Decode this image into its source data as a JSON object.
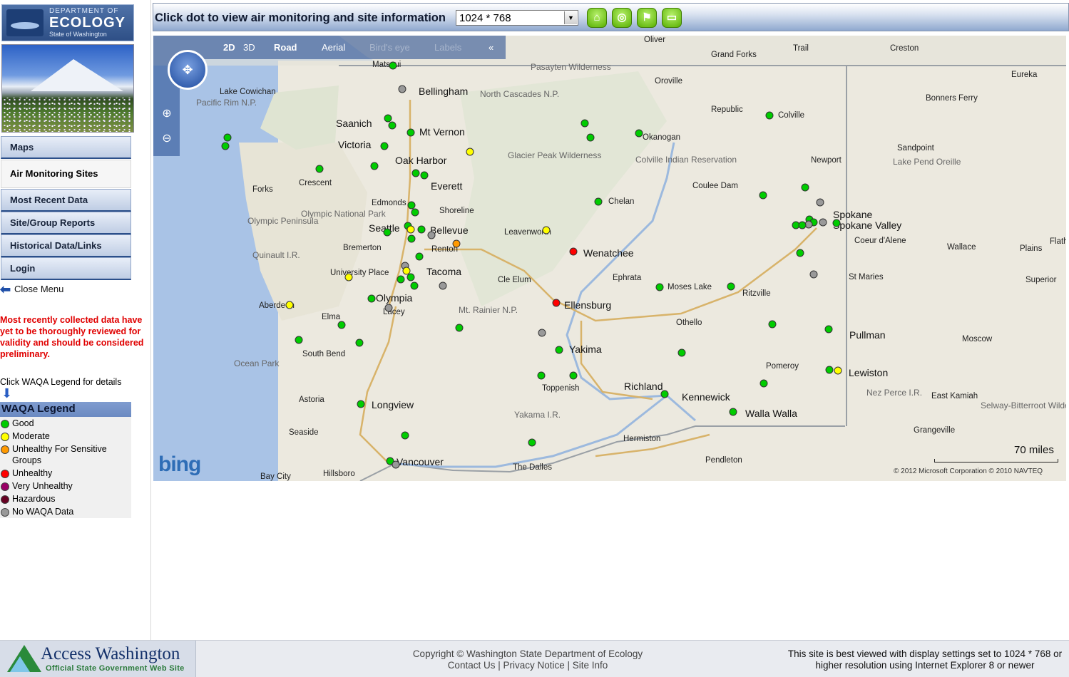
{
  "agency": {
    "line1": "DEPARTMENT OF",
    "line2": "ECOLOGY",
    "line3": "State of Washington"
  },
  "menu": {
    "items": [
      "Maps",
      "Air Monitoring Sites",
      "Most Recent Data",
      "Site/Group Reports",
      "Historical Data/Links",
      "Login"
    ],
    "active": "Air Monitoring Sites",
    "close_label": "Close Menu"
  },
  "notice": {
    "disclaimer": "Most recently collected data have yet to be thoroughly reviewed for validity and should be considered preliminary.",
    "legend_hint": "Click WAQA Legend for details"
  },
  "legend": {
    "title": "WAQA Legend",
    "entries": [
      {
        "label": "Good",
        "color": "#00cc00"
      },
      {
        "label": "Moderate",
        "color": "#ffff00"
      },
      {
        "label": "Unhealthy For Sensitive Groups",
        "color": "#ff9900"
      },
      {
        "label": "Unhealthy",
        "color": "#ff0000"
      },
      {
        "label": "Very Unhealthy",
        "color": "#990066"
      },
      {
        "label": "Hazardous",
        "color": "#660022"
      },
      {
        "label": "No WAQA Data",
        "color": "#999999"
      }
    ]
  },
  "toolbar": {
    "title": "Click dot to view air monitoring and site information",
    "resolution": "1024 * 768",
    "buttons": [
      {
        "icon": "home-icon",
        "glyph": "⌂"
      },
      {
        "icon": "globe-icon",
        "glyph": "◎"
      },
      {
        "icon": "flag-icon",
        "glyph": "⚑"
      },
      {
        "icon": "comment-icon",
        "glyph": "▭"
      }
    ]
  },
  "map_nav": {
    "options": [
      "2D",
      "3D",
      "Road",
      "Aerial",
      "Bird's eye",
      "Labels"
    ],
    "collapse": "«",
    "scale": "70 miles",
    "copyright": "© 2012 Microsoft Corporation   © 2010 NAVTEQ",
    "logo": "bing"
  },
  "map_labels": {
    "cities": [
      "Bellingham",
      "Mt Vernon",
      "Saanich",
      "Victoria",
      "Oak Harbor",
      "Everett",
      "Edmonds",
      "Shoreline",
      "Seattle",
      "Bellevue",
      "Bremerton",
      "Renton",
      "University Place",
      "Tacoma",
      "Olympia",
      "Lacey",
      "Aberdeen",
      "Wenatchee",
      "Ellensburg",
      "Yakima",
      "Richland",
      "Kennewick",
      "Walla Walla",
      "Spokane",
      "Spokane Valley",
      "Pullman",
      "Lewiston",
      "Longview",
      "Vancouver",
      "Colville",
      "Okanogan",
      "Chelan",
      "Leavenworth",
      "Moses Lake",
      "Toppenish",
      "Moscow",
      "Coeur d'Alene"
    ],
    "small": [
      "Matsqui",
      "Lake Cowichan",
      "Pacific Rim N.P.",
      "Forks",
      "Crescent",
      "Olympic Peninsula",
      "Olympic National Park",
      "Quinault I.R.",
      "Elma",
      "South Bend",
      "Ocean Park",
      "Astoria",
      "Seaside",
      "Bay City",
      "Hillsboro",
      "The Dalles",
      "Hermiston",
      "Pendleton",
      "Mt. Rainier N.P.",
      "Cle Elum",
      "Ephrata",
      "Othello",
      "Ritzville",
      "Pomeroy",
      "Nez Perce I.R.",
      "East Kamiah",
      "Grangeville",
      "Colville Indian Reservation",
      "Coulee Dam",
      "Republic",
      "Oroville",
      "Grand Forks",
      "Trail",
      "Creston",
      "Eureka",
      "Bonners Ferry",
      "Sandpoint",
      "Newport",
      "Wallace",
      "Plains",
      "Superior",
      "St Maries",
      "Glacier Peak Wilderness",
      "North Cascades N.P.",
      "Yakama I.R.",
      "Oliver",
      "Pasayten Wilderness",
      "Selway-Bitterroot Wilderness",
      "Lake Pend Oreille",
      "Flathe"
    ],
    "sites_summary": "Air monitoring site dots colored by WAQA category"
  },
  "footer": {
    "brand": "Access Washington",
    "tagline": "Official State Government Web Site",
    "copyright": "Copyright © Washington State Department of Ecology",
    "links": [
      "Contact Us",
      "Privacy Notice",
      "Site Info"
    ],
    "best_viewed": "This site is best viewed with display settings set to 1024 * 768 or higher resolution using Internet Explorer 8 or newer"
  }
}
